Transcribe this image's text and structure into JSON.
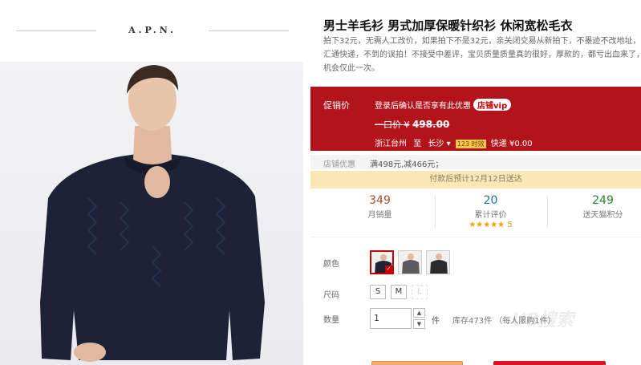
{
  "brand": "A.P.N.",
  "product": {
    "title": "男士羊毛衫 男式加厚保暖针织衫 休闲宽松毛衣",
    "desc_lines": [
      "拍下32元，无需人工改价，如果拍下不是32元，亲关闭交易从新拍下，不墨迹不改地址，",
      "汇通快递，不到的误拍！不接受中差评，宝贝质量质量真的很好，厚款的，都亏出血来了，",
      "机会仅此一次。"
    ]
  },
  "promo": {
    "label": "促销价",
    "login_text": "登录后确认是否享有此优惠",
    "vip_badge": "店铺vip",
    "price_prefix": "一口价 ¥",
    "price": "498.00",
    "from": "浙江台州",
    "to_word": "至",
    "to": "长沙",
    "time_badge": "123 时效",
    "shipping": "快递 ¥0.00"
  },
  "store": {
    "label": "店铺优惠",
    "value": "满498元,减466元；"
  },
  "notice": "付款后预计12月12日送达",
  "stats": [
    {
      "num": "349",
      "label": "月销量",
      "color": "#a0522d"
    },
    {
      "num": "20",
      "label": "累计评价",
      "color": "#1a6fa3",
      "stars": "★★★★★ 5"
    },
    {
      "num": "249",
      "label": "送天猫积分",
      "color": "#2e7d32"
    }
  ],
  "options": {
    "color_label": "颜色",
    "size_label": "尺码",
    "sizes": [
      "S",
      "M",
      "L"
    ],
    "qty_label": "数量",
    "qty_value": "1",
    "qty_unit": "件",
    "stock": "库存473件  （每人限购1件）"
  },
  "watermark": "U8搜索",
  "colors": {
    "promo_bg": "#b3141b",
    "notice_bg": "#fbe7b5",
    "sweater": "#1d2236"
  }
}
